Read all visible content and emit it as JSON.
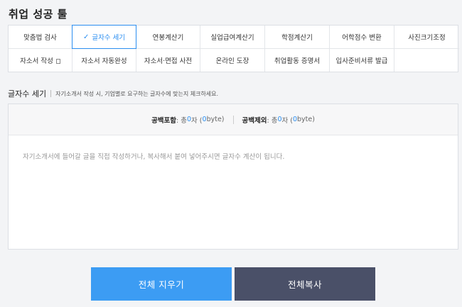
{
  "page": {
    "title": "취업 성공 툴"
  },
  "tools": [
    {
      "label": "맞춤법 검사",
      "active": false
    },
    {
      "label": "글자수 세기",
      "active": true
    },
    {
      "label": "연봉계산기",
      "active": false
    },
    {
      "label": "실업급여계산기",
      "active": false
    },
    {
      "label": "학점계산기",
      "active": false
    },
    {
      "label": "어학점수 변환",
      "active": false
    },
    {
      "label": "사진크기조정",
      "active": false
    },
    {
      "label": "자소서 작성",
      "active": false
    },
    {
      "label": "자소서 자동완성",
      "active": false
    },
    {
      "label": "자소서·면접 사전",
      "active": false
    },
    {
      "label": "온라인 도장",
      "active": false
    },
    {
      "label": "취업활동 증명서",
      "active": false
    },
    {
      "label": "입사준비서류 발급",
      "active": false
    },
    {
      "label": "",
      "active": false
    }
  ],
  "section": {
    "title": "글자수 세기",
    "description": "자기소개서 작성 시, 기업별로 요구하는 글자수에 맞는지 체크하세요."
  },
  "counter": {
    "with_space_label": "공백포함",
    "with_space_prefix": " : 총 ",
    "with_space_value": "0",
    "with_space_suffix": "자 (",
    "with_space_bytes": "0",
    "with_space_unit": "byte)",
    "without_space_label": "공백제외",
    "without_space_prefix": " : 총 ",
    "without_space_value": "0",
    "without_space_suffix": "자 (",
    "without_space_bytes": "0",
    "without_space_unit": "byte)"
  },
  "editor": {
    "placeholder": "자기소개서에 들어갈 글을 직접 작성하거나, 복사해서 붙여 넣어주시면 글자수 계산이 됩니다."
  },
  "buttons": {
    "clear_label": "전체 지우기",
    "copy_label": "전체복사"
  },
  "colors": {
    "accent": "#2b8ef0",
    "clear_button": "#3c9cf3",
    "copy_button": "#4a5068"
  }
}
